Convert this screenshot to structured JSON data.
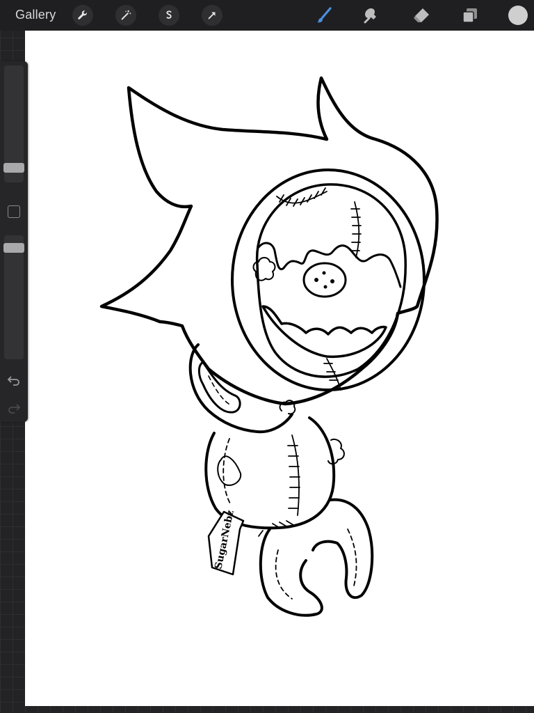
{
  "topbar": {
    "gallery_label": "Gallery",
    "left_tools": [
      "wrench-icon",
      "magic-wand-icon",
      "selection-icon",
      "transform-arrow-icon"
    ],
    "right_tools": [
      "brush-icon",
      "smudge-icon",
      "eraser-icon",
      "layers-icon"
    ],
    "active_tool": "brush",
    "active_color": "#4a90e2",
    "current_color": "#cfcfcf"
  },
  "sidebar": {
    "brush_size_level": 0.28,
    "opacity_level": 0.9,
    "icons": [
      "modify-square-icon",
      "undo-icon",
      "redo-icon"
    ]
  },
  "artwork": {
    "signature_text": "SugarNebz",
    "description_colors": {
      "line": "#000000",
      "background": "#ffffff"
    }
  }
}
